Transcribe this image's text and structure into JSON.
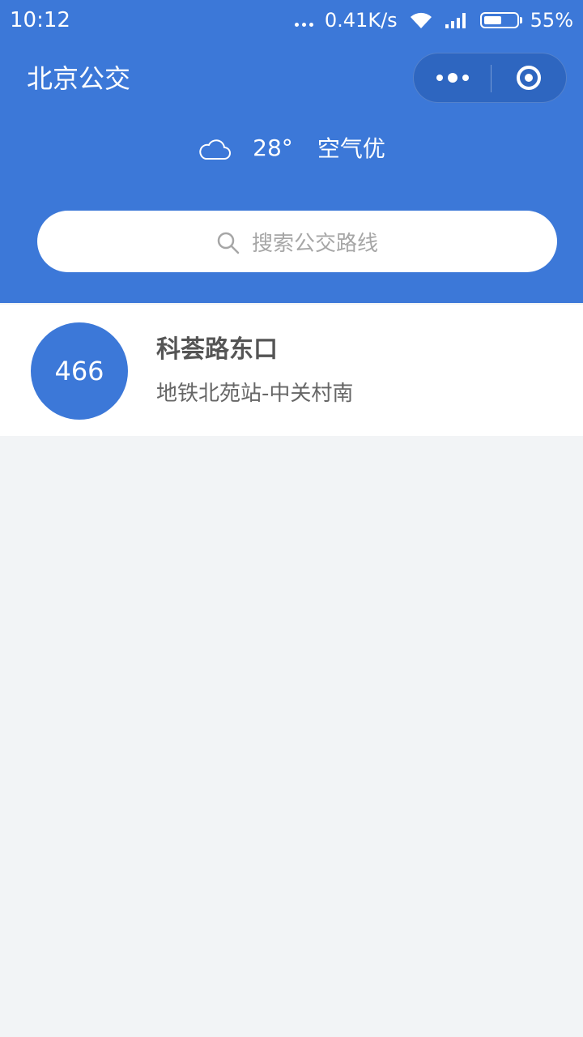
{
  "status_bar": {
    "time": "10:12",
    "network_speed": "0.41K/s",
    "battery_percent": "55%",
    "battery_level": 0.55
  },
  "header": {
    "title": "北京公交",
    "accent_color": "#3c78d8"
  },
  "weather": {
    "icon": "cloud-icon",
    "temperature": "28°",
    "air_quality": "空气优"
  },
  "search": {
    "placeholder": "搜索公交路线"
  },
  "routes": [
    {
      "number": "466",
      "stop": "科荟路东口",
      "direction": "地铁北苑站-中关村南"
    }
  ]
}
